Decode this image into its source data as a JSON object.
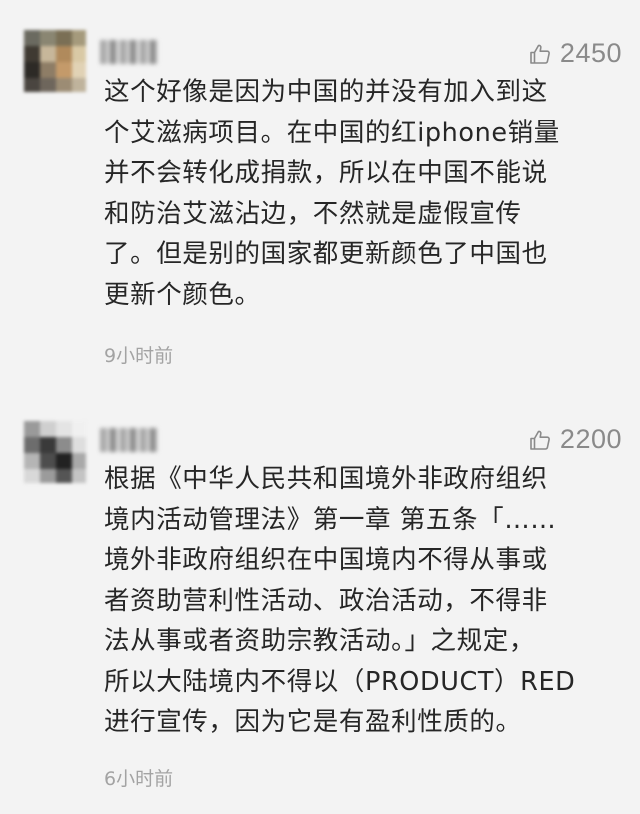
{
  "comments": [
    {
      "likes": "2450",
      "text": "这个好像是因为中国的并没有加入到这\n个艾滋病项目。在中国的红iphone销量\n并不会转化成捐款，所以在中国不能说\n和防治艾滋沾边，不然就是虚假宣传\n了。但是别的国家都更新颜色了中国也\n更新个颜色。",
      "time": "9小时前",
      "icons": {
        "like": "thumbs-up-icon"
      }
    },
    {
      "likes": "2200",
      "text": "根据《中华人民共和国境外非政府组织\n境内活动管理法》第一章 第五条「……\n境外非政府组织在中国境内不得从事或\n者资助营利性活动、政治活动，不得非\n法从事或者资助宗教活动。」之规定，\n所以大陆境内不得以（PRODUCT）RED\n进行宣传，因为它是有盈利性质的。",
      "time": "6小时前",
      "icons": {
        "like": "thumbs-up-icon"
      }
    }
  ],
  "colors": {
    "background": "#f3f3f3",
    "text": "#262626",
    "muted": "#8a8a8a",
    "timestamp": "#a3a3a3"
  }
}
